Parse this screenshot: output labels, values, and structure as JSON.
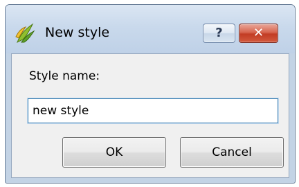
{
  "window": {
    "title": "New style",
    "app_icon": "qgis-leaf-icon",
    "help_glyph": "?",
    "close_glyph": "✕"
  },
  "form": {
    "label": "Style name:",
    "input_value": "new style"
  },
  "buttons": {
    "ok": "OK",
    "cancel": "Cancel"
  },
  "colors": {
    "frame": "#c3d3e5",
    "close_button": "#c94a32",
    "input_focus_border": "#3c7fb1"
  }
}
